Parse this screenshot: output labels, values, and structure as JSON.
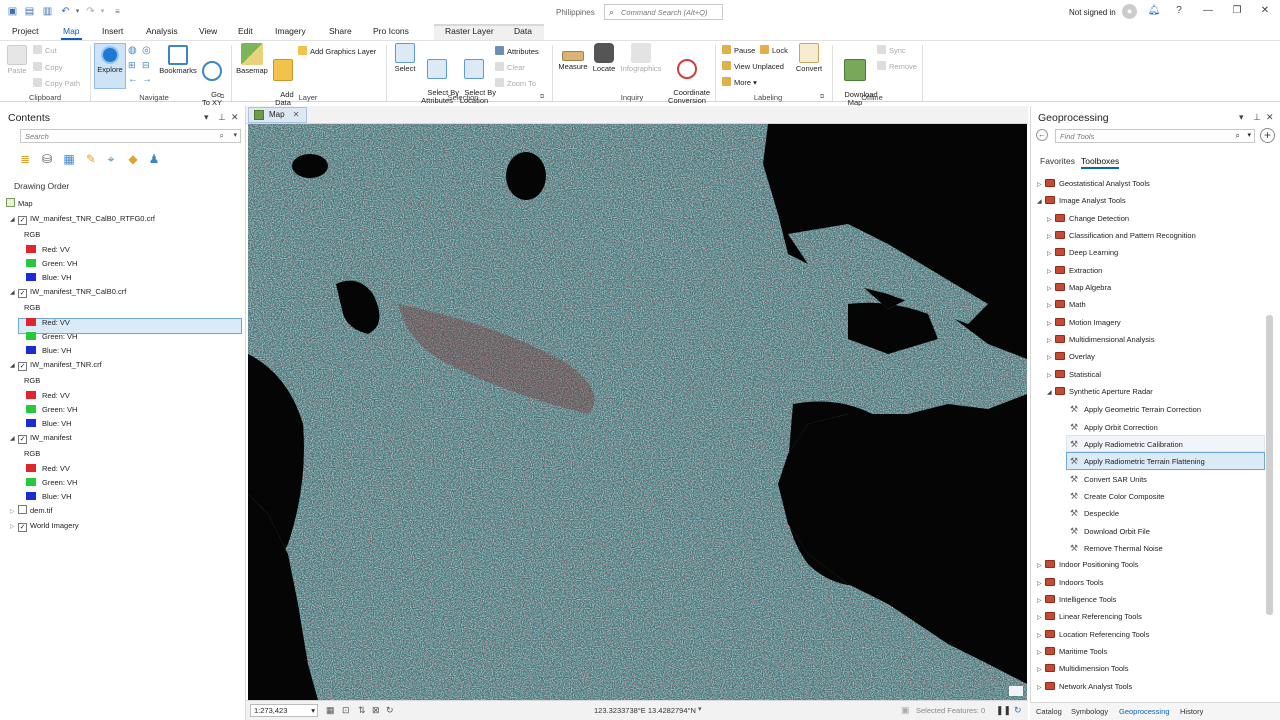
{
  "titlebar": {
    "project_name": "Philippines",
    "command_search_placeholder": "Command Search (Alt+Q)",
    "signin_text": "Not signed in",
    "help_label": "?"
  },
  "ribbon_tabs": [
    "Project",
    "Map",
    "Insert",
    "Analysis",
    "View",
    "Edit",
    "Imagery",
    "Share",
    "Pro Icons",
    "Raster Layer",
    "Data"
  ],
  "ribbon": {
    "clipboard": {
      "label": "Clipboard",
      "paste": "Paste",
      "cut": "Cut",
      "copy": "Copy",
      "copy_path": "Copy Path"
    },
    "navigate": {
      "label": "Navigate",
      "explore": "Explore",
      "bookmarks": "Bookmarks",
      "go_to_xy": "Go\nTo XY"
    },
    "layer": {
      "label": "Layer",
      "basemap": "Basemap",
      "add_data": "Add\nData",
      "add_graphics_layer": "Add Graphics Layer"
    },
    "selection": {
      "label": "Selection",
      "select": "Select",
      "select_by_attributes": "Select By\nAttributes",
      "select_by_location": "Select By\nLocation",
      "attributes": "Attributes",
      "clear": "Clear",
      "zoom_to": "Zoom To"
    },
    "inquiry": {
      "label": "Inquiry",
      "measure": "Measure",
      "locate": "Locate",
      "infographics": "Infographics",
      "coordinate_conversion": "Coordinate\nConversion"
    },
    "labeling": {
      "label": "Labeling",
      "pause": "Pause",
      "lock": "Lock",
      "view_unplaced": "View Unplaced",
      "more": "More",
      "convert": "Convert"
    },
    "offline": {
      "label": "Offline",
      "download_map": "Download\nMap",
      "sync": "Sync",
      "remove": "Remove"
    }
  },
  "contents": {
    "title": "Contents",
    "search_placeholder": "Search",
    "drawing_order": "Drawing Order",
    "map_label": "Map",
    "layers": [
      {
        "name": "IW_manifest_TNR_CalB0_RTFG0.crf",
        "checked": true,
        "band_type": "RGB",
        "red": "Red:  VV",
        "green": "Green: VH",
        "blue": "Blue:  VH"
      },
      {
        "name": "IW_manifest_TNR_CalB0.crf",
        "checked": true,
        "band_type": "RGB",
        "red": "Red:  VV",
        "green": "Green: VH",
        "blue": "Blue:  VH"
      },
      {
        "name": "IW_manifest_TNR.crf",
        "checked": true,
        "band_type": "RGB",
        "red": "Red:  VV",
        "green": "Green: VH",
        "blue": "Blue:  VH"
      },
      {
        "name": "IW_manifest",
        "checked": true,
        "band_type": "RGB",
        "red": "Red:  VV",
        "green": "Green: VH",
        "blue": "Blue:  VH"
      }
    ],
    "extra_layers": [
      {
        "name": "dem.tif",
        "checked": false
      },
      {
        "name": "World Imagery",
        "checked": true
      }
    ],
    "swatch_colors": {
      "red": "#e0262b",
      "green": "#27c93a",
      "blue": "#1d2bd6"
    }
  },
  "map": {
    "tab_label": "Map",
    "scale": "1:273,423",
    "coordinates": "123.3233738°E 13.4282794°N",
    "selected_features": "Selected Features: 0"
  },
  "geoprocessing": {
    "title": "Geoprocessing",
    "search_placeholder": "Find Tools",
    "tabs": [
      "Favorites",
      "Toolboxes"
    ],
    "active_tab": "Toolboxes",
    "tree": [
      {
        "label": "Geostatistical Analyst Tools",
        "level": 0,
        "kind": "box",
        "expanded": false
      },
      {
        "label": "Image Analyst Tools",
        "level": 0,
        "kind": "box",
        "expanded": true
      },
      {
        "label": "Change Detection",
        "level": 1,
        "kind": "box",
        "expanded": false
      },
      {
        "label": "Classification and Pattern Recognition",
        "level": 1,
        "kind": "box",
        "expanded": false
      },
      {
        "label": "Deep Learning",
        "level": 1,
        "kind": "box",
        "expanded": false
      },
      {
        "label": "Extraction",
        "level": 1,
        "kind": "box",
        "expanded": false
      },
      {
        "label": "Map Algebra",
        "level": 1,
        "kind": "box",
        "expanded": false
      },
      {
        "label": "Math",
        "level": 1,
        "kind": "box",
        "expanded": false
      },
      {
        "label": "Motion Imagery",
        "level": 1,
        "kind": "box",
        "expanded": false
      },
      {
        "label": "Multidimensional Analysis",
        "level": 1,
        "kind": "box",
        "expanded": false
      },
      {
        "label": "Overlay",
        "level": 1,
        "kind": "box",
        "expanded": false
      },
      {
        "label": "Statistical",
        "level": 1,
        "kind": "box",
        "expanded": false
      },
      {
        "label": "Synthetic Aperture Radar",
        "level": 1,
        "kind": "box",
        "expanded": true
      },
      {
        "label": "Apply Geometric Terrain Correction",
        "level": 2,
        "kind": "tool"
      },
      {
        "label": "Apply Orbit Correction",
        "level": 2,
        "kind": "tool"
      },
      {
        "label": "Apply Radiometric Calibration",
        "level": 2,
        "kind": "tool"
      },
      {
        "label": "Apply Radiometric Terrain Flattening",
        "level": 2,
        "kind": "tool"
      },
      {
        "label": "Convert SAR Units",
        "level": 2,
        "kind": "tool"
      },
      {
        "label": "Create Color Composite",
        "level": 2,
        "kind": "tool"
      },
      {
        "label": "Despeckle",
        "level": 2,
        "kind": "tool"
      },
      {
        "label": "Download Orbit File",
        "level": 2,
        "kind": "tool"
      },
      {
        "label": "Remove Thermal Noise",
        "level": 2,
        "kind": "tool"
      },
      {
        "label": "Indoor Positioning Tools",
        "level": 0,
        "kind": "box",
        "expanded": false
      },
      {
        "label": "Indoors Tools",
        "level": 0,
        "kind": "box",
        "expanded": false
      },
      {
        "label": "Intelligence Tools",
        "level": 0,
        "kind": "box",
        "expanded": false
      },
      {
        "label": "Linear Referencing Tools",
        "level": 0,
        "kind": "box",
        "expanded": false
      },
      {
        "label": "Location Referencing Tools",
        "level": 0,
        "kind": "box",
        "expanded": false
      },
      {
        "label": "Maritime Tools",
        "level": 0,
        "kind": "box",
        "expanded": false
      },
      {
        "label": "Multidimension Tools",
        "level": 0,
        "kind": "box",
        "expanded": false
      },
      {
        "label": "Network Analyst Tools",
        "level": 0,
        "kind": "box",
        "expanded": false
      }
    ]
  },
  "bottom_tabs": [
    "Catalog",
    "Symbology",
    "Geoprocessing",
    "History"
  ],
  "bottom_active_tab": "Geoprocessing",
  "colors": {
    "accent": "#0b63b5",
    "selection_bg": "#dbeaf7",
    "toolbox_red": "#c44a36"
  }
}
